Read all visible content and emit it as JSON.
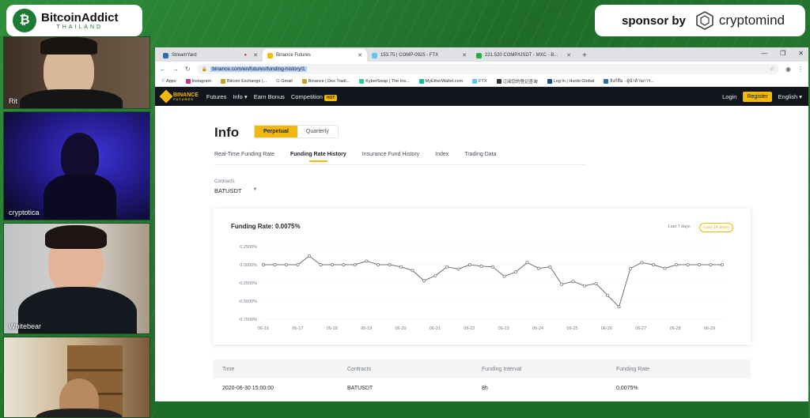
{
  "overlay": {
    "logo_title": "BitcoinAddict",
    "logo_sub": "THAILAND",
    "sponsor_label": "sponsor by",
    "sponsor_name": "cryptomind"
  },
  "cams": [
    {
      "name": "Rit"
    },
    {
      "name": "cryptotica"
    },
    {
      "name": "Whitebear"
    },
    {
      "name": ""
    }
  ],
  "browser": {
    "tabs": [
      {
        "label": "StreamYard",
        "active": false
      },
      {
        "label": "Binance Futures",
        "active": true
      },
      {
        "label": "153.75 | COMP-0925 - FTX",
        "active": false
      },
      {
        "label": "221.520 COMP/USDT - MXC - B...",
        "active": false
      }
    ],
    "url": "binance.com/en/futures/funding-history/1",
    "bookmarks": [
      "Apps",
      "Instagram",
      "Bitcoin Exchange |...",
      "Gmail",
      "Binance | Dex Tradi...",
      "KyberSwap | The Ins...",
      "MyEtherWallet.com",
      "FTX",
      "订阅您的登记查询",
      "Log In | Huobi Global",
      "ลิงก์ลืม - ผู้นำด้านการ..."
    ]
  },
  "binance": {
    "logo_top": "BINANCE",
    "logo_bottom": "FUTURES",
    "nav": [
      "Futures",
      "Info ▾",
      "Earn Bonus",
      "Competition"
    ],
    "hot": "HOT",
    "login": "Login",
    "register": "Register",
    "language": "English ▾"
  },
  "page": {
    "title": "Info",
    "seg_perpetual": "Perpetual",
    "seg_quarterly": "Quarterly",
    "subtabs": [
      "Real-Time Funding Rate",
      "Funding Rate History",
      "Insurance Fund History",
      "Index",
      "Trading Data"
    ],
    "contracts_label": "Contracts",
    "contracts_value": "BATUSDT",
    "chart_title": "Funding Rate: 0.0075%",
    "range_7": "Last 7 days",
    "range_14": "Last 14 days",
    "table_headers": [
      "Time",
      "Contracts",
      "Funding Interval",
      "Funding Rate"
    ],
    "table_row": [
      "2020-06-30 15:00:00",
      "BATUSDT",
      "8h",
      "0.0075%"
    ]
  },
  "chart_data": {
    "type": "line",
    "yticks": [
      "0.2500%",
      "0.0000%",
      "-0.2500%",
      "-0.5000%",
      "-0.7500%"
    ],
    "ylim": [
      -0.75,
      0.25
    ],
    "xticks": [
      "06-16",
      "06-17",
      "06-18",
      "06-19",
      "06-20",
      "06-21",
      "06-22",
      "06-23",
      "06-24",
      "06-25",
      "06-26",
      "06-27",
      "06-28",
      "06-29"
    ],
    "values": [
      0.0,
      0.0,
      0.0,
      0.0,
      0.12,
      0.0,
      0.0,
      0.0,
      0.0,
      0.05,
      0.0,
      0.0,
      -0.03,
      -0.08,
      -0.22,
      -0.15,
      -0.03,
      -0.06,
      0.0,
      -0.02,
      -0.03,
      -0.16,
      -0.1,
      0.03,
      -0.05,
      -0.03,
      -0.27,
      -0.23,
      -0.29,
      -0.26,
      -0.42,
      -0.58,
      -0.05,
      0.03,
      0.0,
      -0.05,
      0.0,
      0.0,
      0.0,
      0.0,
      0.0
    ],
    "line_color": "#707070"
  }
}
